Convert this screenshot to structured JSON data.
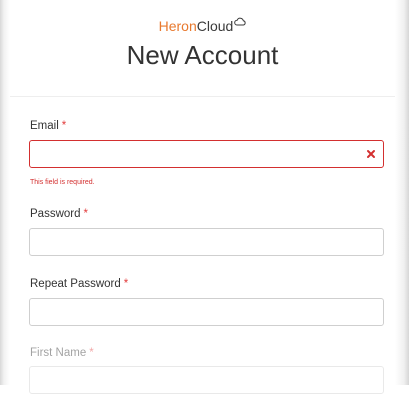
{
  "brand": {
    "part1": "Heron",
    "part2": "Cloud",
    "icon": "cloud-icon"
  },
  "page": {
    "title": "New Account"
  },
  "form": {
    "email": {
      "label": "Email",
      "required_mark": "*",
      "value": "",
      "error": "This field is required.",
      "clear_icon": "close-icon"
    },
    "password": {
      "label": "Password",
      "required_mark": "*",
      "value": ""
    },
    "repeat_password": {
      "label": "Repeat Password",
      "required_mark": "*",
      "value": ""
    },
    "first_name": {
      "label": "First Name",
      "required_mark": "*",
      "value": ""
    }
  },
  "colors": {
    "brand_accent": "#e8792e",
    "error": "#d32f2f",
    "required": "#e23b3b"
  }
}
